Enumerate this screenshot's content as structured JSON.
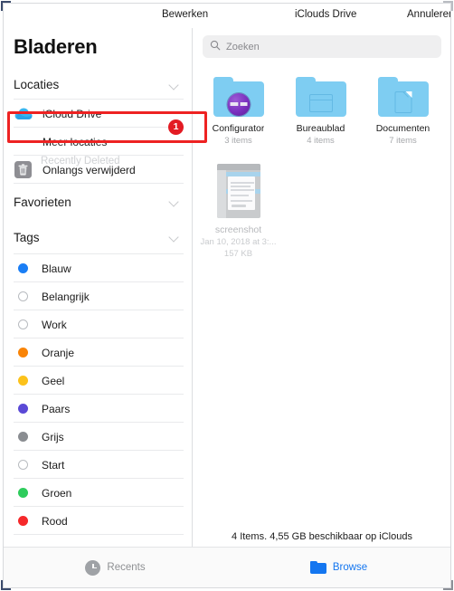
{
  "topbar": {
    "edit": "Bewerken",
    "title": "iClouds Drive",
    "cancel": "Annuleren"
  },
  "sidebar": {
    "title": "Bladeren",
    "sections": [
      {
        "label": "Locaties",
        "items": [
          {
            "label": "iCloud Drive",
            "icon": "cloud-icon"
          },
          {
            "label": "Meer locaties",
            "icon": "ellipsis-icon",
            "badge": "1",
            "highlighted": true
          },
          {
            "label": "Onlangs verwijderd",
            "icon": "trash-icon"
          }
        ]
      },
      {
        "label": "Favorieten",
        "items": []
      },
      {
        "label": "Tags",
        "items": [
          {
            "label": "Blauw",
            "color": "#1a7ef5"
          },
          {
            "label": "Belangrijk",
            "color": ""
          },
          {
            "label": "Work",
            "color": ""
          },
          {
            "label": "Oranje",
            "color": "#f98407"
          },
          {
            "label": "Geel",
            "color": "#fcc21b"
          },
          {
            "label": "Paars",
            "color": "#5a49d6"
          },
          {
            "label": "Grijs",
            "color": "#8a8d91"
          },
          {
            "label": "Start",
            "color": ""
          },
          {
            "label": "Groen",
            "color": "#2ecc5c"
          },
          {
            "label": "Rood",
            "color": "#f5282a"
          }
        ]
      }
    ],
    "ghost_label": "Recently Deleted"
  },
  "search": {
    "placeholder": "Zoeken",
    "icon": "search-icon"
  },
  "files": [
    {
      "name": "Configurator",
      "sub": "3 items",
      "kind": "folder-configurator"
    },
    {
      "name": "Bureaublad",
      "sub": "4 items",
      "kind": "folder-desktop"
    },
    {
      "name": "Documenten",
      "sub": "7 items",
      "kind": "folder-documents"
    },
    {
      "name": "screenshot",
      "sub": "Jan 10, 2018 at 3:...",
      "sub2": "157 KB",
      "kind": "image-thumbnail"
    }
  ],
  "status": "4 Items. 4,55 GB beschikbaar op iClouds",
  "tabbar": {
    "recents": "Recents",
    "browse": "Browse"
  },
  "colors": {
    "accent": "#1476f0",
    "annotation": "#ee2222",
    "badge": "#e31b23",
    "folder": "#7ecdf2"
  }
}
